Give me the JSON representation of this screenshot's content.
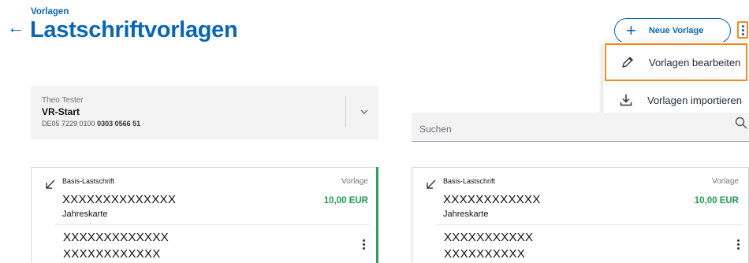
{
  "header": {
    "breadcrumb": "Vorlagen",
    "title": "Lastschriftvorlagen",
    "back_icon": "arrow-left-icon",
    "new_button_label": "Neue Vorlage"
  },
  "menu": {
    "items": [
      {
        "label": "Vorlagen bearbeiten",
        "icon": "pencil-icon"
      },
      {
        "label": "Vorlagen importieren",
        "icon": "download-icon"
      }
    ]
  },
  "account": {
    "holder": "Theo Tester",
    "name": "VR-Start",
    "iban_prefix": "DE05 7229 0100",
    "iban_suffix": "0303 0566 51"
  },
  "search": {
    "placeholder": "Suchen"
  },
  "cards": [
    {
      "type": "Basis-Lastschrift",
      "badge": "Vorlage",
      "payee": "XXXXXXXXXXXXXX",
      "amount": "10,00 EUR",
      "purpose": "Jahreskarte",
      "ref1": "XXXXXXXXXXXXX",
      "ref2": "XXXXXXXXXXXX"
    },
    {
      "type": "Basis-Lastschrift",
      "badge": "Vorlage",
      "payee": "XXXXXXXXXXXX",
      "amount": "10,00 EUR",
      "purpose": "Jahreskarte",
      "ref1": "XXXXXXXXXXX",
      "ref2": "XXXXXXXXXX"
    }
  ],
  "colors": {
    "brand": "#0a66b3",
    "highlight": "#f08a24",
    "amount": "#1e9a55"
  }
}
